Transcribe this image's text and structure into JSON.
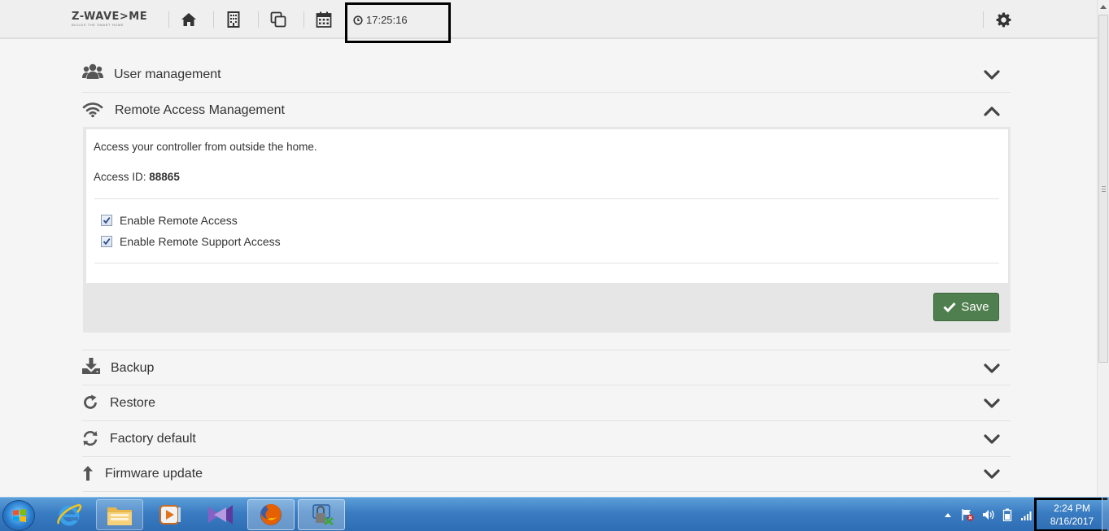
{
  "header": {
    "logo_text": "Z-WAVE>ME",
    "logo_tagline": "BUILDS THE SMART HOME",
    "clock": "17:25:16",
    "nav": [
      {
        "icon": "home-icon"
      },
      {
        "icon": "building-icon"
      },
      {
        "icon": "copy-icon"
      },
      {
        "icon": "calendar-icon"
      }
    ],
    "settings_icon": "gear-icon"
  },
  "sections": [
    {
      "label": "User management",
      "icon": "users-icon",
      "state": "collapsed"
    },
    {
      "label": "Remote Access Management",
      "icon": "wifi-icon",
      "state": "expanded"
    },
    {
      "label": "Backup",
      "icon": "download-icon",
      "state": "collapsed"
    },
    {
      "label": "Restore",
      "icon": "restore-icon",
      "state": "collapsed"
    },
    {
      "label": "Factory default",
      "icon": "refresh-icon",
      "state": "collapsed"
    },
    {
      "label": "Firmware update",
      "icon": "upload-arrow-icon",
      "state": "collapsed"
    }
  ],
  "remote_access": {
    "description": "Access your controller from outside the home.",
    "access_id_label": "Access ID:",
    "access_id": "88865",
    "options": [
      {
        "label": "Enable Remote Access",
        "checked": true
      },
      {
        "label": "Enable Remote Support Access",
        "checked": true
      }
    ],
    "save_label": "Save"
  },
  "taskbar": {
    "apps": [
      {
        "icon": "internet-explorer-icon"
      },
      {
        "icon": "file-explorer-icon"
      },
      {
        "icon": "media-player-icon"
      },
      {
        "icon": "visual-studio-icon"
      },
      {
        "icon": "firefox-icon",
        "active": true
      },
      {
        "icon": "network-lock-icon",
        "active": true
      }
    ],
    "time": "2:24 PM",
    "date": "8/16/2017"
  },
  "colors": {
    "save_green": "#4f7f4f",
    "taskbar_blue": "#3a7cc2",
    "topbar_bg": "#efefef"
  }
}
